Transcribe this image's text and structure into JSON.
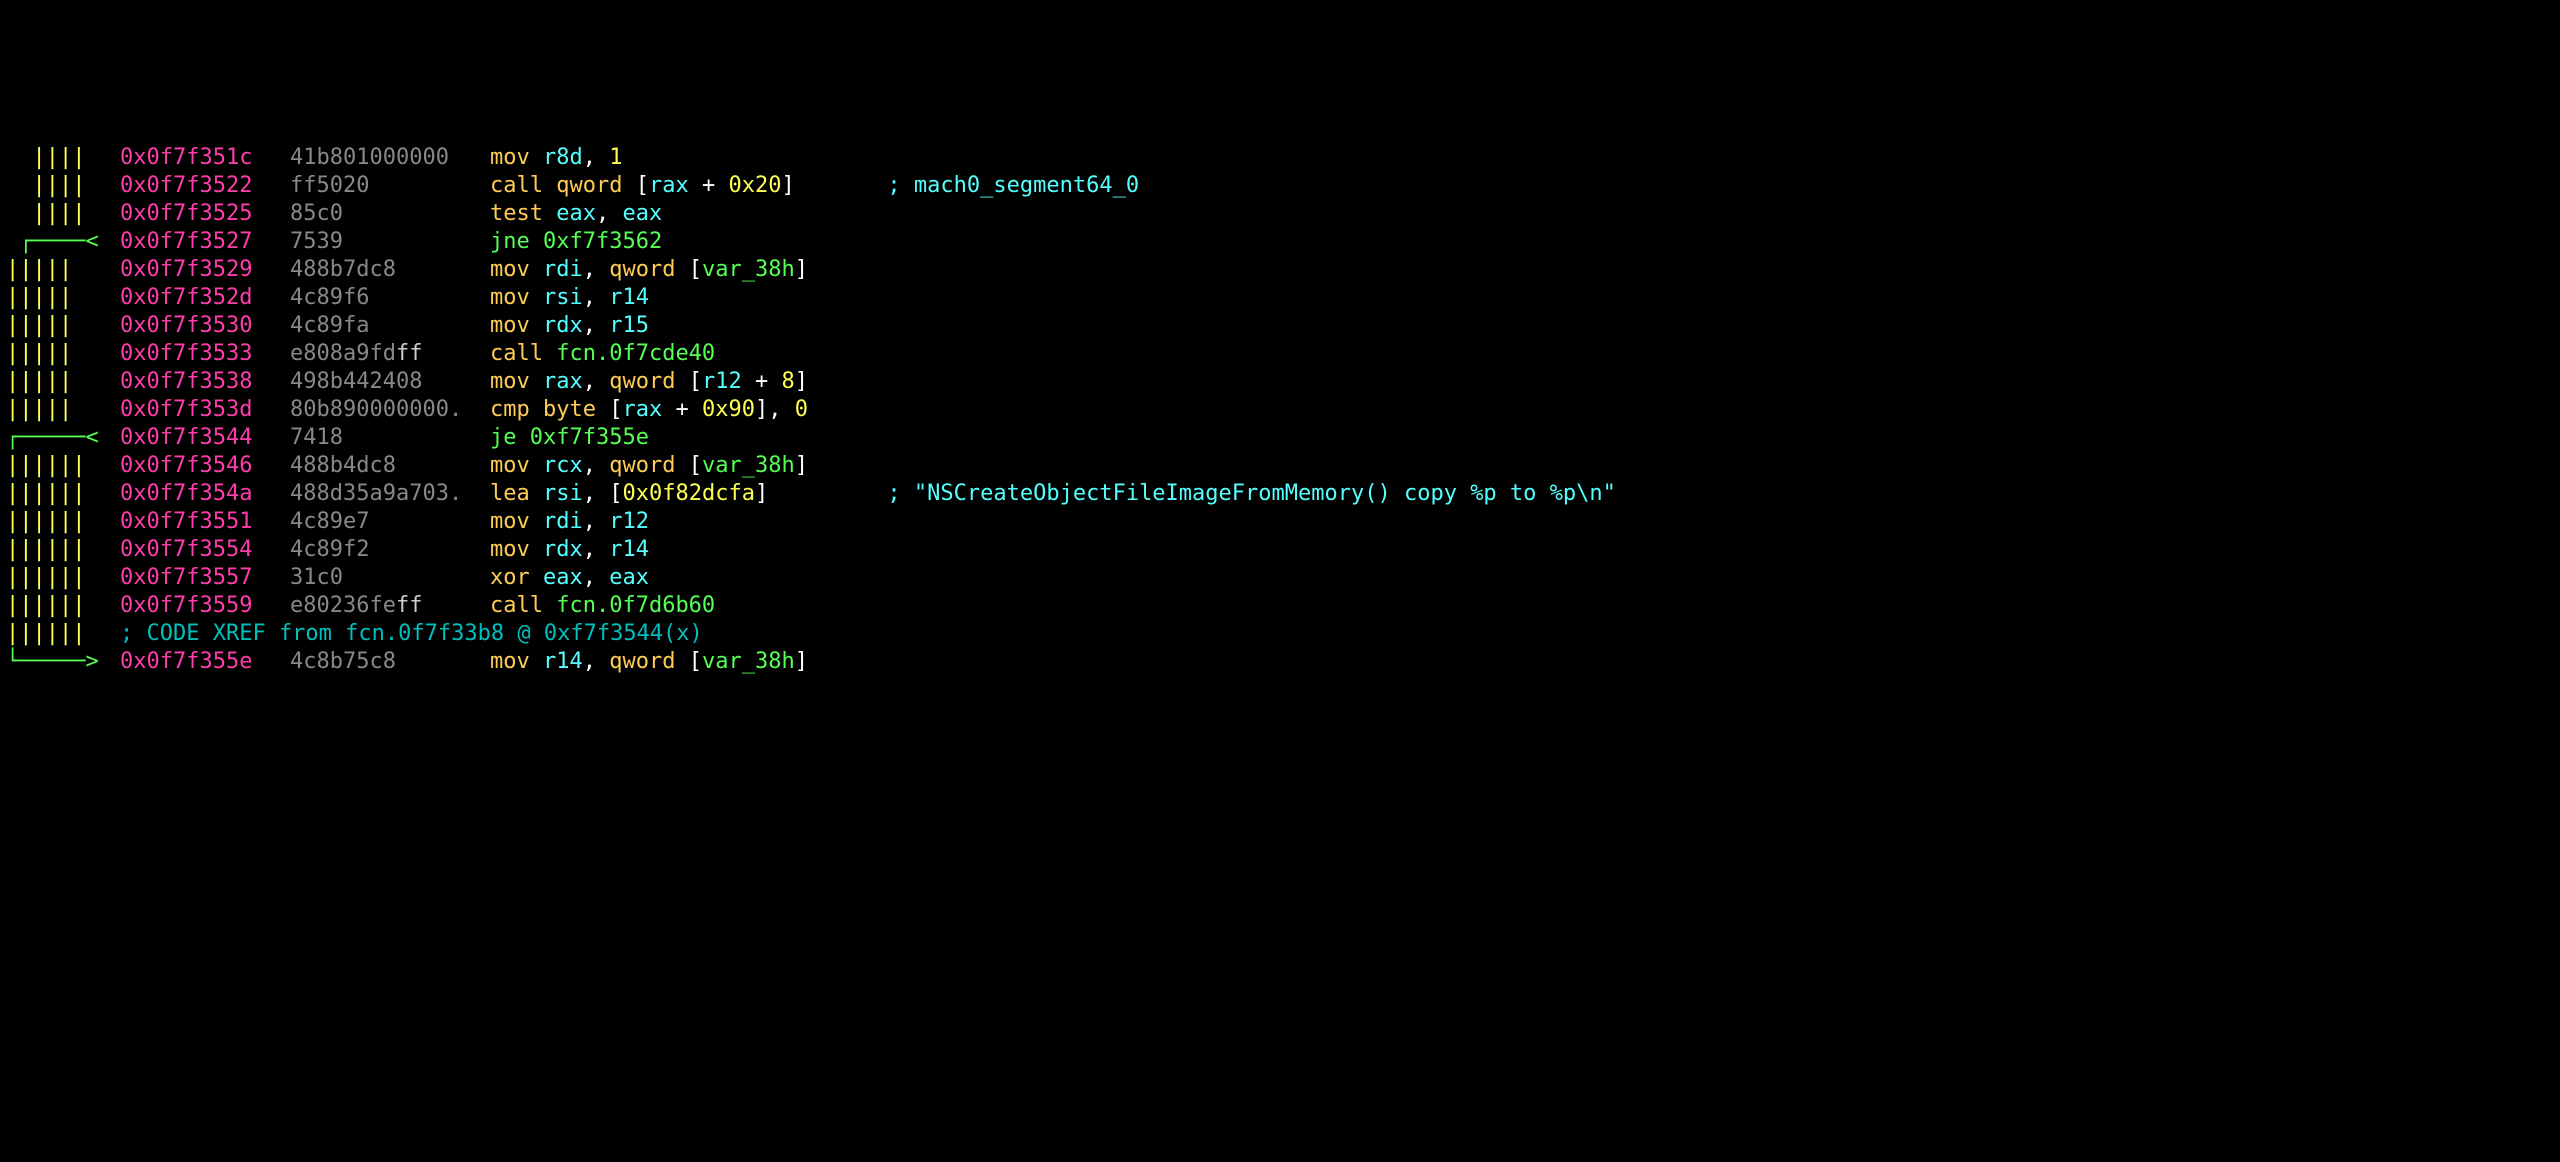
{
  "rows": [
    {
      "flow": "  ||||",
      "flow_color": "c-flow1",
      "addr": "0x0f7f351c",
      "bytes": "41b801000000",
      "bytes_tail": "",
      "asm": [
        {
          "t": "mov ",
          "c": "c-mn"
        },
        {
          "t": "r8d",
          "c": "c-reg"
        },
        {
          "t": ", ",
          "c": "c-white"
        },
        {
          "t": "1",
          "c": "c-num"
        }
      ],
      "comment": ""
    },
    {
      "flow": "  ||||",
      "flow_color": "c-flow1",
      "addr": "0x0f7f3522",
      "bytes": "ff5020",
      "bytes_tail": "",
      "asm": [
        {
          "t": "call qword ",
          "c": "c-call"
        },
        {
          "t": "[",
          "c": "c-white"
        },
        {
          "t": "rax",
          "c": "c-reg"
        },
        {
          "t": " + ",
          "c": "c-white"
        },
        {
          "t": "0x20",
          "c": "c-num"
        },
        {
          "t": "]",
          "c": "c-white"
        }
      ],
      "comment": "; mach0_segment64_0"
    },
    {
      "flow": "  ||||",
      "flow_color": "c-flow1",
      "addr": "0x0f7f3525",
      "bytes": "85c0",
      "bytes_tail": "",
      "asm": [
        {
          "t": "test ",
          "c": "c-mn"
        },
        {
          "t": "eax",
          "c": "c-reg"
        },
        {
          "t": ", ",
          "c": "c-white"
        },
        {
          "t": "eax",
          "c": "c-reg"
        }
      ],
      "comment": ""
    },
    {
      "flow": " ┌────<",
      "flow_color": "c-flow2",
      "addr": "0x0f7f3527",
      "bytes": "7539",
      "bytes_tail": "",
      "asm": [
        {
          "t": "jne ",
          "c": "c-green"
        },
        {
          "t": "0xf7f3562",
          "c": "c-green"
        }
      ],
      "comment": ""
    },
    {
      "flow": "|||||",
      "flow_color": "c-flow1",
      "addr": "0x0f7f3529",
      "bytes": "488b7dc8",
      "bytes_tail": "",
      "asm": [
        {
          "t": "mov ",
          "c": "c-mn"
        },
        {
          "t": "rdi",
          "c": "c-reg"
        },
        {
          "t": ", ",
          "c": "c-white"
        },
        {
          "t": "qword ",
          "c": "c-mn"
        },
        {
          "t": "[",
          "c": "c-white"
        },
        {
          "t": "var_38h",
          "c": "c-green"
        },
        {
          "t": "]",
          "c": "c-white"
        }
      ],
      "comment": ""
    },
    {
      "flow": "|||||",
      "flow_color": "c-flow1",
      "addr": "0x0f7f352d",
      "bytes": "4c89f6",
      "bytes_tail": "",
      "asm": [
        {
          "t": "mov ",
          "c": "c-mn"
        },
        {
          "t": "rsi",
          "c": "c-reg"
        },
        {
          "t": ", ",
          "c": "c-white"
        },
        {
          "t": "r14",
          "c": "c-reg"
        }
      ],
      "comment": ""
    },
    {
      "flow": "|||||",
      "flow_color": "c-flow1",
      "addr": "0x0f7f3530",
      "bytes": "4c89fa",
      "bytes_tail": "",
      "asm": [
        {
          "t": "mov ",
          "c": "c-mn"
        },
        {
          "t": "rdx",
          "c": "c-reg"
        },
        {
          "t": ", ",
          "c": "c-white"
        },
        {
          "t": "r15",
          "c": "c-reg"
        }
      ],
      "comment": ""
    },
    {
      "flow": "|||||",
      "flow_color": "c-flow1",
      "addr": "0x0f7f3533",
      "bytes": "e808a9fd",
      "bytes_tail": "ff",
      "asm": [
        {
          "t": "call ",
          "c": "c-call"
        },
        {
          "t": "fcn.0f7cde40",
          "c": "c-green"
        }
      ],
      "comment": ""
    },
    {
      "flow": "|||||",
      "flow_color": "c-flow1",
      "addr": "0x0f7f3538",
      "bytes": "498b442408",
      "bytes_tail": "",
      "asm": [
        {
          "t": "mov ",
          "c": "c-mn"
        },
        {
          "t": "rax",
          "c": "c-reg"
        },
        {
          "t": ", ",
          "c": "c-white"
        },
        {
          "t": "qword ",
          "c": "c-mn"
        },
        {
          "t": "[",
          "c": "c-white"
        },
        {
          "t": "r12",
          "c": "c-reg"
        },
        {
          "t": " + ",
          "c": "c-white"
        },
        {
          "t": "8",
          "c": "c-num"
        },
        {
          "t": "]",
          "c": "c-white"
        }
      ],
      "comment": ""
    },
    {
      "flow": "|||||",
      "flow_color": "c-flow1",
      "addr": "0x0f7f353d",
      "bytes": "80b890000000.",
      "bytes_tail": "",
      "asm": [
        {
          "t": "cmp byte ",
          "c": "c-mn"
        },
        {
          "t": "[",
          "c": "c-white"
        },
        {
          "t": "rax",
          "c": "c-reg"
        },
        {
          "t": " + ",
          "c": "c-white"
        },
        {
          "t": "0x90",
          "c": "c-num"
        },
        {
          "t": "], ",
          "c": "c-white"
        },
        {
          "t": "0",
          "c": "c-num"
        }
      ],
      "comment": ""
    },
    {
      "flow": "┌─────<",
      "flow_color": "c-flow2",
      "addr": "0x0f7f3544",
      "bytes": "7418",
      "bytes_tail": "",
      "asm": [
        {
          "t": "je ",
          "c": "c-green"
        },
        {
          "t": "0xf7f355e",
          "c": "c-green"
        }
      ],
      "comment": ""
    },
    {
      "flow": "||||||",
      "flow_color": "c-flow1",
      "addr": "0x0f7f3546",
      "bytes": "488b4dc8",
      "bytes_tail": "",
      "asm": [
        {
          "t": "mov ",
          "c": "c-mn"
        },
        {
          "t": "rcx",
          "c": "c-reg"
        },
        {
          "t": ", ",
          "c": "c-white"
        },
        {
          "t": "qword ",
          "c": "c-mn"
        },
        {
          "t": "[",
          "c": "c-white"
        },
        {
          "t": "var_38h",
          "c": "c-green"
        },
        {
          "t": "]",
          "c": "c-white"
        }
      ],
      "comment": ""
    },
    {
      "flow": "||||||",
      "flow_color": "c-flow1",
      "addr": "0x0f7f354a",
      "bytes": "488d35a9a703.",
      "bytes_tail": "",
      "asm": [
        {
          "t": "lea ",
          "c": "c-mn"
        },
        {
          "t": "rsi",
          "c": "c-reg"
        },
        {
          "t": ", ",
          "c": "c-white"
        },
        {
          "t": "[",
          "c": "c-white"
        },
        {
          "t": "0x0f82dcfa",
          "c": "c-num"
        },
        {
          "t": "]",
          "c": "c-white"
        }
      ],
      "comment": "; \"NSCreateObjectFileImageFromMemory() copy %p to %p\\n\""
    },
    {
      "flow": "||||||",
      "flow_color": "c-flow1",
      "addr": "0x0f7f3551",
      "bytes": "4c89e7",
      "bytes_tail": "",
      "asm": [
        {
          "t": "mov ",
          "c": "c-mn"
        },
        {
          "t": "rdi",
          "c": "c-reg"
        },
        {
          "t": ", ",
          "c": "c-white"
        },
        {
          "t": "r12",
          "c": "c-reg"
        }
      ],
      "comment": ""
    },
    {
      "flow": "||||||",
      "flow_color": "c-flow1",
      "addr": "0x0f7f3554",
      "bytes": "4c89f2",
      "bytes_tail": "",
      "asm": [
        {
          "t": "mov ",
          "c": "c-mn"
        },
        {
          "t": "rdx",
          "c": "c-reg"
        },
        {
          "t": ", ",
          "c": "c-white"
        },
        {
          "t": "r14",
          "c": "c-reg"
        }
      ],
      "comment": ""
    },
    {
      "flow": "||||||",
      "flow_color": "c-flow1",
      "addr": "0x0f7f3557",
      "bytes": "31c0",
      "bytes_tail": "",
      "asm": [
        {
          "t": "xor ",
          "c": "c-mn"
        },
        {
          "t": "eax",
          "c": "c-reg"
        },
        {
          "t": ", ",
          "c": "c-white"
        },
        {
          "t": "eax",
          "c": "c-reg"
        }
      ],
      "comment": ""
    },
    {
      "flow": "||||||",
      "flow_color": "c-flow1",
      "addr": "0x0f7f3559",
      "bytes": "e80236fe",
      "bytes_tail": "ff",
      "asm": [
        {
          "t": "call ",
          "c": "c-call"
        },
        {
          "t": "fcn.0f7d6b60",
          "c": "c-green"
        }
      ],
      "comment": ""
    },
    {
      "flow": "||||||",
      "flow_color": "c-flow1",
      "xref": "; CODE XREF from fcn.0f7f33b8 @ 0xf7f3544(x)"
    },
    {
      "flow": "└─────>",
      "flow_color": "c-flow2",
      "addr": "0x0f7f355e",
      "bytes": "4c8b75c8",
      "bytes_tail": "",
      "asm": [
        {
          "t": "mov ",
          "c": "c-mn"
        },
        {
          "t": "r14",
          "c": "c-reg"
        },
        {
          "t": ", ",
          "c": "c-white"
        },
        {
          "t": "qword ",
          "c": "c-mn"
        },
        {
          "t": "[",
          "c": "c-white"
        },
        {
          "t": "var_38h",
          "c": "c-green"
        },
        {
          "t": "]",
          "c": "c-white"
        }
      ],
      "comment": ""
    }
  ],
  "comment_col": 64
}
